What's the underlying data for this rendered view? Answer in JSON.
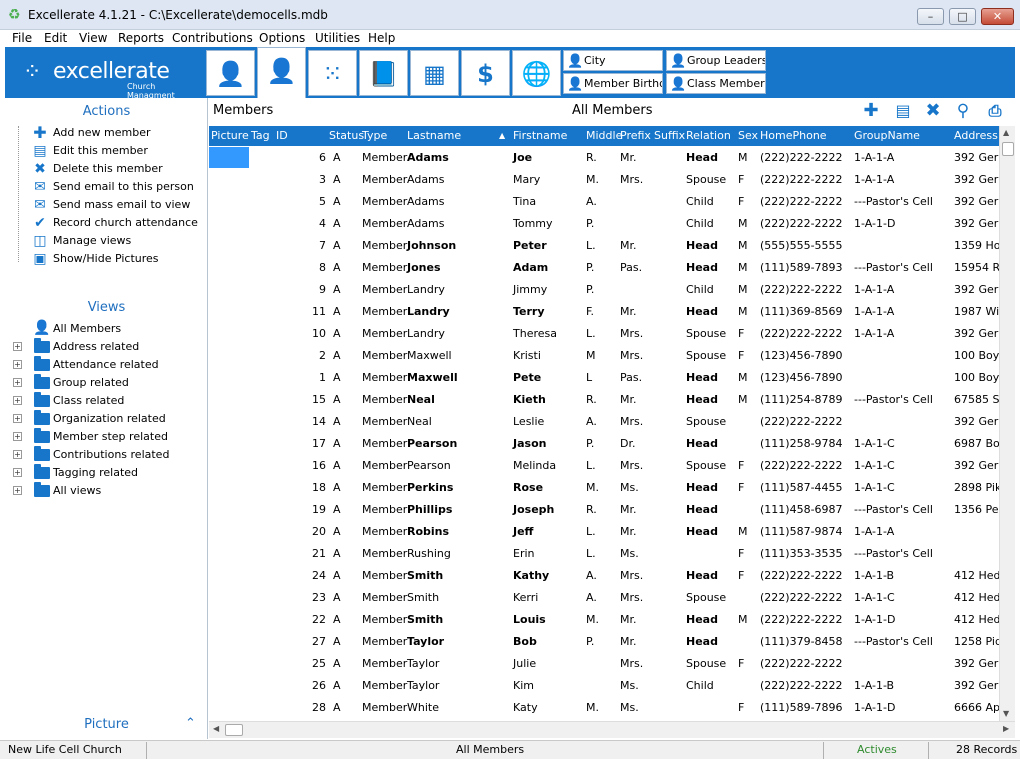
{
  "window": {
    "title": "Excellerate 4.1.21 - C:\\Excellerate\\democells.mdb",
    "controls": [
      "–",
      "□",
      "✕"
    ]
  },
  "menu": [
    "File",
    "Edit",
    "View",
    "Reports",
    "Contributions",
    "Options",
    "Utilities",
    "Help"
  ],
  "brand": {
    "name": "excellerate",
    "tagline": "Church Managment"
  },
  "quick_views": [
    "City",
    "Member Birthda",
    "Group Leaders",
    "Class Members"
  ],
  "sidebar": {
    "actions_title": "Actions",
    "actions": [
      "Add new member",
      "Edit this member",
      "Delete this member",
      "Send email to this person",
      "Send mass email to view",
      "Record church attendance",
      "Manage views",
      "Show/Hide Pictures"
    ],
    "views_title": "Views",
    "views": [
      "All Members",
      "Address related",
      "Attendance related",
      "Group related",
      "Class related",
      "Organization related",
      "Member step related",
      "Contributions related",
      "Tagging related",
      "All views"
    ],
    "picture_label": "Picture"
  },
  "main": {
    "title": "Members",
    "view_name": "All Members",
    "columns": [
      "Picture",
      "Tag",
      "ID",
      "Status",
      "Type",
      "Lastname",
      "Firstname",
      "Middle",
      "Prefix",
      "Suffix",
      "Relation",
      "Sex",
      "HomePhone",
      "GroupName",
      "Address"
    ],
    "sort_indicator": "▲",
    "rows": [
      [
        "6",
        "A",
        "Member",
        "Adams",
        "Joe",
        "R.",
        "Mr.",
        "",
        "Head",
        "M",
        "(222)222-2222",
        "1-A-1-A",
        "392 Gerr"
      ],
      [
        "3",
        "A",
        "Member",
        "Adams",
        "Mary",
        "M.",
        "Mrs.",
        "",
        "Spouse",
        "F",
        "(222)222-2222",
        "1-A-1-A",
        "392 Gerr"
      ],
      [
        "5",
        "A",
        "Member",
        "Adams",
        "Tina",
        "A.",
        "",
        "",
        "Child",
        "F",
        "(222)222-2222",
        "---Pastor's Cell",
        "392 Gerr"
      ],
      [
        "4",
        "A",
        "Member",
        "Adams",
        "Tommy",
        "P.",
        "",
        "",
        "Child",
        "M",
        "(222)222-2222",
        "1-A-1-D",
        "392 Gerr"
      ],
      [
        "7",
        "A",
        "Member",
        "Johnson",
        "Peter",
        "L.",
        "Mr.",
        "",
        "Head",
        "M",
        "(555)555-5555",
        "",
        "1359 Ho"
      ],
      [
        "8",
        "A",
        "Member",
        "Jones",
        "Adam",
        "P.",
        "Pas.",
        "",
        "Head",
        "M",
        "(111)589-7893",
        "---Pastor's Cell",
        "15954 Ri"
      ],
      [
        "9",
        "A",
        "Member",
        "Landry",
        "Jimmy",
        "P.",
        "",
        "",
        "Child",
        "M",
        "(222)222-2222",
        "1-A-1-A",
        "392 Gerr"
      ],
      [
        "11",
        "A",
        "Member",
        "Landry",
        "Terry",
        "F.",
        "Mr.",
        "",
        "Head",
        "M",
        "(111)369-8569",
        "1-A-1-A",
        "1987 Wil"
      ],
      [
        "10",
        "A",
        "Member",
        "Landry",
        "Theresa",
        "L.",
        "Mrs.",
        "",
        "Spouse",
        "F",
        "(222)222-2222",
        "1-A-1-A",
        "392 Gerr"
      ],
      [
        "2",
        "A",
        "Member",
        "Maxwell",
        "Kristi",
        "M",
        "Mrs.",
        "",
        "Spouse",
        "F",
        "(123)456-7890",
        "",
        "100 Boyd"
      ],
      [
        "1",
        "A",
        "Member",
        "Maxwell",
        "Pete",
        "L",
        "Pas.",
        "",
        "Head",
        "M",
        "(123)456-7890",
        "",
        "100 Boyd"
      ],
      [
        "15",
        "A",
        "Member",
        "Neal",
        "Kieth",
        "R.",
        "Mr.",
        "",
        "Head",
        "M",
        "(111)254-8789",
        "---Pastor's Cell",
        "67585 Su"
      ],
      [
        "14",
        "A",
        "Member",
        "Neal",
        "Leslie",
        "A.",
        "Mrs.",
        "",
        "Spouse",
        "",
        "(222)222-2222",
        "",
        "392 Gerr"
      ],
      [
        "17",
        "A",
        "Member",
        "Pearson",
        "Jason",
        "P.",
        "Dr.",
        "",
        "Head",
        "",
        "(111)258-9784",
        "1-A-1-C",
        "6987 Boy"
      ],
      [
        "16",
        "A",
        "Member",
        "Pearson",
        "Melinda",
        "L.",
        "Mrs.",
        "",
        "Spouse",
        "F",
        "(222)222-2222",
        "1-A-1-C",
        "392 Gerr"
      ],
      [
        "18",
        "A",
        "Member",
        "Perkins",
        "Rose",
        "M.",
        "Ms.",
        "",
        "Head",
        "F",
        "(111)587-4455",
        "1-A-1-C",
        "2898 Pik"
      ],
      [
        "19",
        "A",
        "Member",
        "Phillips",
        "Joseph",
        "R.",
        "Mr.",
        "",
        "Head",
        "",
        "(111)458-6987",
        "---Pastor's Cell",
        "1356 Per"
      ],
      [
        "20",
        "A",
        "Member",
        "Robins",
        "Jeff",
        "L.",
        "Mr.",
        "",
        "Head",
        "M",
        "(111)587-9874",
        "1-A-1-A",
        ""
      ],
      [
        "21",
        "A",
        "Member",
        "Rushing",
        "Erin",
        "L.",
        "Ms.",
        "",
        "",
        "F",
        "(111)353-3535",
        "---Pastor's Cell",
        ""
      ],
      [
        "24",
        "A",
        "Member",
        "Smith",
        "Kathy",
        "A.",
        "Mrs.",
        "",
        "Head",
        "F",
        "(222)222-2222",
        "1-A-1-B",
        "412 Hed"
      ],
      [
        "23",
        "A",
        "Member",
        "Smith",
        "Kerri",
        "A.",
        "Mrs.",
        "",
        "Spouse",
        "",
        "(222)222-2222",
        "1-A-1-C",
        "412 Hed"
      ],
      [
        "22",
        "A",
        "Member",
        "Smith",
        "Louis",
        "M.",
        "Mr.",
        "",
        "Head",
        "M",
        "(222)222-2222",
        "1-A-1-D",
        "412 Hed"
      ],
      [
        "27",
        "A",
        "Member",
        "Taylor",
        "Bob",
        "P.",
        "Mr.",
        "",
        "Head",
        "",
        "(111)379-8458",
        "---Pastor's Cell",
        "1258 Pid"
      ],
      [
        "25",
        "A",
        "Member",
        "Taylor",
        "Julie",
        "",
        "Mrs.",
        "",
        "Spouse",
        "F",
        "(222)222-2222",
        "",
        "392 Gerr"
      ],
      [
        "26",
        "A",
        "Member",
        "Taylor",
        "Kim",
        "",
        "Ms.",
        "",
        "Child",
        "",
        "(222)222-2222",
        "1-A-1-B",
        "392 Gerr"
      ],
      [
        "28",
        "A",
        "Member",
        "White",
        "Katy",
        "M.",
        "Ms.",
        "",
        "",
        "F",
        "(111)589-7896",
        "1-A-1-D",
        "6666 Ap"
      ]
    ],
    "bold_rows": [
      0,
      4,
      5,
      7,
      10,
      11,
      13,
      15,
      16,
      17,
      19,
      21,
      22
    ]
  },
  "status": {
    "church": "New Life Cell Church",
    "view": "All Members",
    "filter": "Actives",
    "records": "28 Records"
  },
  "colors": {
    "accent": "#1776c9",
    "header_text": "#1f6fbf",
    "actives": "#2e8b2e",
    "selection": "#3399ff"
  }
}
